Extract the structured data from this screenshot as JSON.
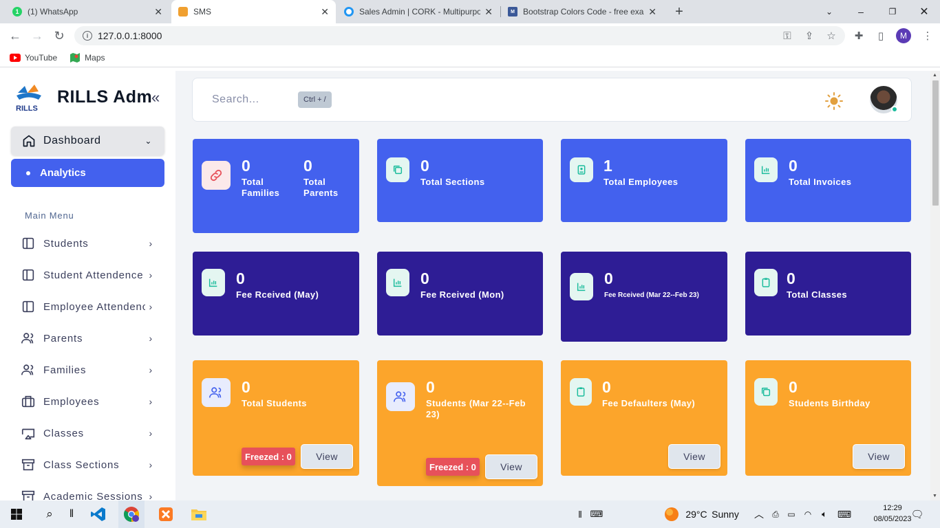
{
  "browser": {
    "tabs": [
      {
        "title": "(1) WhatsApp"
      },
      {
        "title": "SMS"
      },
      {
        "title": "Sales Admin | CORK - Multipurpose"
      },
      {
        "title": "Bootstrap Colors Code - free exa"
      }
    ],
    "url": "127.0.0.1:8000",
    "bookmarks": [
      {
        "label": "YouTube"
      },
      {
        "label": "Maps"
      }
    ],
    "profile_initial": "M"
  },
  "sidebar": {
    "brand": "RILLS Adm",
    "logo_text": "RILLS",
    "dashboard": "Dashboard",
    "analytics": "Analytics",
    "main_menu": "Main Menu",
    "items": [
      {
        "label": "Students"
      },
      {
        "label": "Student Attendence"
      },
      {
        "label": "Employee Attendence"
      },
      {
        "label": "Parents"
      },
      {
        "label": "Families"
      },
      {
        "label": "Employees"
      },
      {
        "label": "Classes"
      },
      {
        "label": "Class Sections"
      },
      {
        "label": "Academic Sessions"
      }
    ]
  },
  "header": {
    "search_placeholder": "Search...",
    "shortcut": "Ctrl + /"
  },
  "cards": {
    "families_value": "0",
    "families_label": "Total Families",
    "parents_value": "0",
    "parents_label": "Total Parents",
    "sections_value": "0",
    "sections_label": "Total Sections",
    "employees_value": "1",
    "employees_label": "Total Employees",
    "invoices_value": "0",
    "invoices_label": "Total Invoices",
    "fee_may_value": "0",
    "fee_may_label": "Fee Rceived (May)",
    "fee_mon_value": "0",
    "fee_mon_label": "Fee Rceived (Mon)",
    "fee_year_value": "0",
    "fee_year_label": "Fee Rceived (Mar 22--Feb 23)",
    "classes_value": "0",
    "classes_label": "Total Classes",
    "students_value": "0",
    "students_label": "Total Students",
    "students_freeze": "Freezed : 0",
    "students_year_value": "0",
    "students_year_label": "Students (Mar 22--Feb 23)",
    "students_year_freeze": "Freezed : 0",
    "defaulters_value": "0",
    "defaulters_label": "Fee Defaulters (May)",
    "birthday_value": "0",
    "birthday_label": "Students Birthday",
    "view": "View"
  },
  "taskbar": {
    "weather": "29°C",
    "weather_desc": "Sunny",
    "time": "12:29",
    "date": "08/05/2023"
  },
  "colors": {
    "primary": "#4361ee",
    "navy": "#2e1d95",
    "orange": "#fca52b",
    "danger": "#e7515a"
  }
}
